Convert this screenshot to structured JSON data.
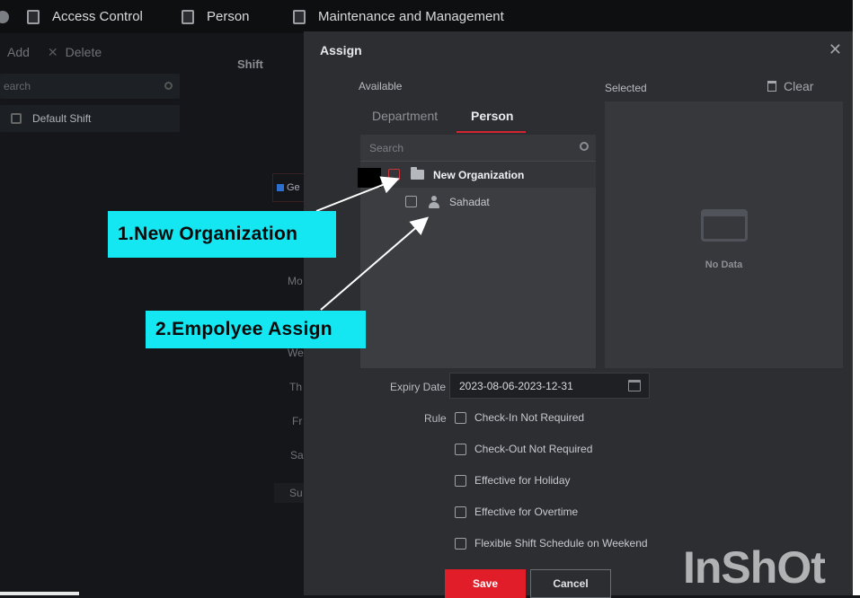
{
  "nav": {
    "items": [
      {
        "label": "Access Control",
        "icon": "door-icon"
      },
      {
        "label": "Person",
        "icon": "person-card-icon"
      },
      {
        "label": "Maintenance and Management",
        "icon": "document-icon"
      }
    ]
  },
  "background": {
    "add_label": "Add",
    "delete_label": "Delete",
    "search_placeholder": "earch",
    "shift_item": "Default Shift",
    "shift_heading": "Shift",
    "blue_tag": "Ge",
    "days": [
      "Mo",
      "We",
      "Th",
      "Fr",
      "Sa",
      "Su"
    ]
  },
  "modal": {
    "title": "Assign",
    "available_label": "Available",
    "selected_label": "Selected",
    "clear_label": "Clear",
    "tabs": [
      {
        "label": "Department",
        "active": false
      },
      {
        "label": "Person",
        "active": true
      }
    ],
    "search_placeholder": "Search",
    "tree": {
      "organization": "New Organization",
      "person": "Sahadat"
    },
    "no_data": "No Data",
    "expiry_label": "Expiry Date",
    "expiry_value": "2023-08-06-2023-12-31",
    "rule_label": "Rule",
    "rules": [
      "Check-In Not Required",
      "Check-Out Not Required",
      "Effective for Holiday",
      "Effective for Overtime",
      "Flexible Shift Schedule on Weekend"
    ],
    "save_label": "Save",
    "cancel_label": "Cancel"
  },
  "annotations": {
    "callout1": "1.New Organization",
    "callout2": "2.Empolyee Assign",
    "watermark": "InShOt"
  },
  "colors": {
    "accent_red": "#e11d2a",
    "callout_cyan": "#14e6f2"
  }
}
